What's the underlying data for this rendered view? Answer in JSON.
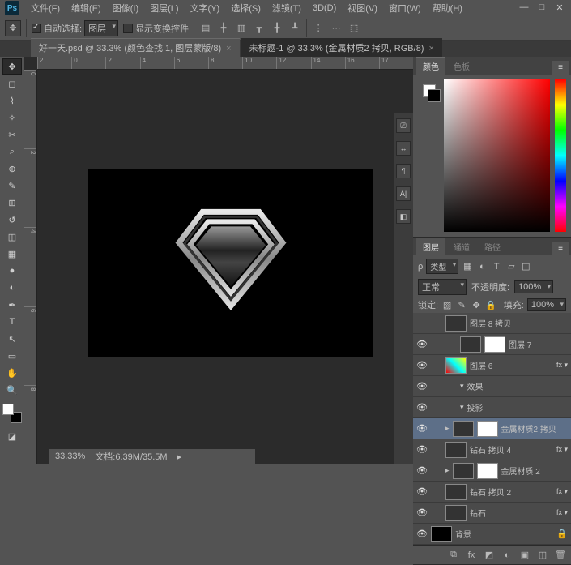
{
  "menu": {
    "items": [
      "文件(F)",
      "编辑(E)",
      "图像(I)",
      "图层(L)",
      "文字(Y)",
      "选择(S)",
      "滤镜(T)",
      "3D(D)",
      "视图(V)",
      "窗口(W)",
      "帮助(H)"
    ],
    "logo": "Ps"
  },
  "options": {
    "autoSelect": "自动选择:",
    "autoSelectMode": "图层",
    "showTransform": "显示变换控件"
  },
  "tabs": [
    {
      "label": "好一天.psd @ 33.3% (颜色查找 1, 图层蒙版/8)",
      "active": false
    },
    {
      "label": "未标题-1 @ 33.3% (金属材质2 拷贝, RGB/8)",
      "active": true
    }
  ],
  "rulerH": [
    "2",
    "0",
    "2",
    "4",
    "6",
    "8",
    "10",
    "12",
    "14",
    "16",
    "17"
  ],
  "rulerV": [
    "0",
    "2",
    "4",
    "6",
    "8"
  ],
  "status": {
    "zoom": "33.33%",
    "doc": "文档:6.39M/35.5M"
  },
  "colorPanel": {
    "tabs": [
      "颜色",
      "色板"
    ]
  },
  "layersPanel": {
    "tabs": [
      "图层",
      "通道",
      "路径"
    ],
    "kind": "类型",
    "blend": "正常",
    "opacityLabel": "不透明度:",
    "opacity": "100%",
    "lockLabel": "锁定:",
    "fillLabel": "填充:",
    "fill": "100%",
    "layers": [
      {
        "vis": false,
        "name": "图层 8 拷贝",
        "indent": 1,
        "thumb": "img"
      },
      {
        "vis": true,
        "name": "图层 7",
        "indent": 2,
        "thumb": "img",
        "mask": true
      },
      {
        "vis": true,
        "name": "图层 6",
        "indent": 1,
        "thumb": "color",
        "fx": true
      },
      {
        "vis": true,
        "name": "效果",
        "indent": 2,
        "sub": true
      },
      {
        "vis": true,
        "name": "投影",
        "indent": 2,
        "sub": true
      },
      {
        "vis": true,
        "name": "金属材质2 拷贝",
        "indent": 1,
        "thumb": "img",
        "mask": true,
        "sel": true,
        "clip": true
      },
      {
        "vis": true,
        "name": "钻石 拷贝 4",
        "indent": 1,
        "thumb": "img",
        "fx": true
      },
      {
        "vis": true,
        "name": "金属材质 2",
        "indent": 1,
        "thumb": "img",
        "mask": true,
        "clip": true
      },
      {
        "vis": true,
        "name": "钻石 拷贝 2",
        "indent": 1,
        "thumb": "img",
        "fx": true
      },
      {
        "vis": true,
        "name": "钻石",
        "indent": 1,
        "thumb": "img",
        "fx": true
      },
      {
        "vis": true,
        "name": "背景",
        "indent": 0,
        "thumb": "black",
        "lock": true
      }
    ]
  },
  "narrowIcons": [
    "⎚",
    "↔",
    "¶",
    "A|",
    "◧"
  ]
}
